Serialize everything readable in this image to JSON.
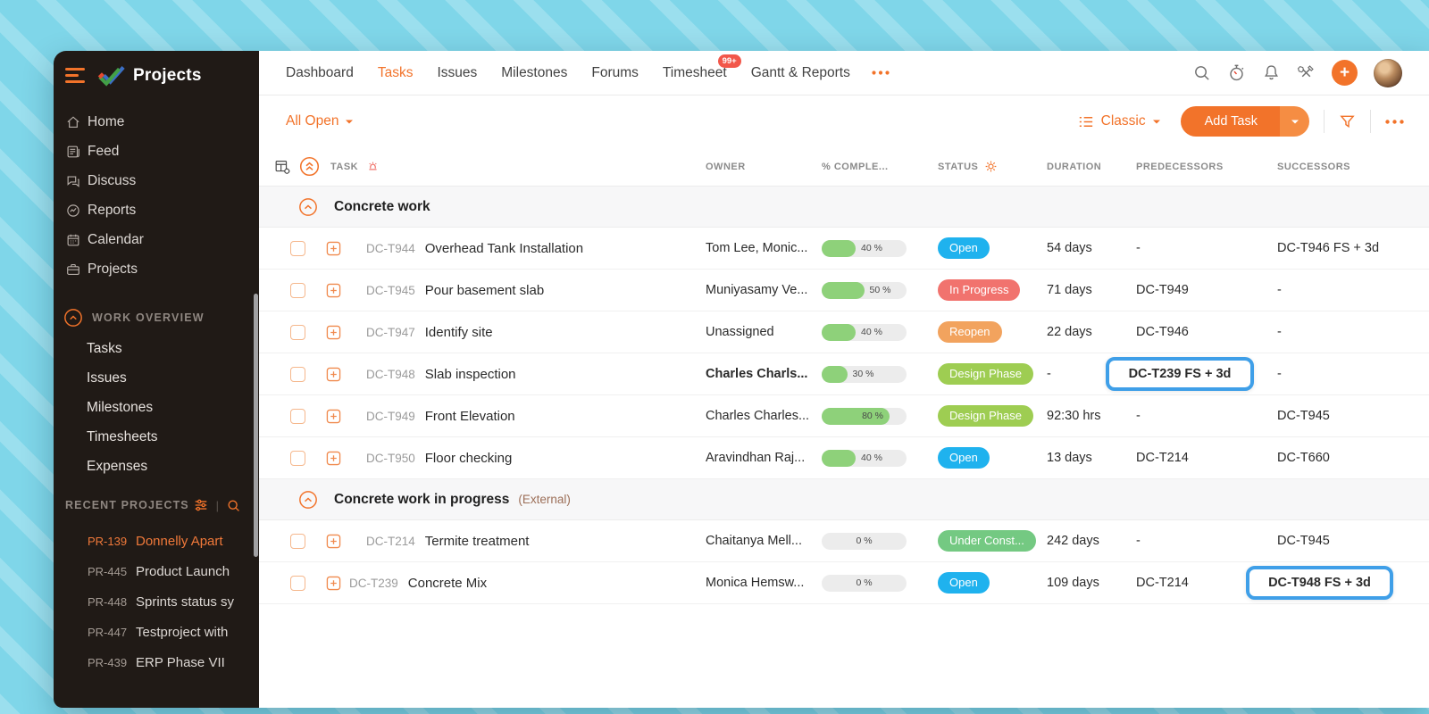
{
  "colors": {
    "accent_orange": "#f2732a",
    "highlight_blue": "#3f9fe8",
    "progress_green": "#8ed17a",
    "status": {
      "Open": "#1fb2ee",
      "In Progress": "#f1736e",
      "Reopen": "#f2a35e",
      "Design Phase": "#9ecd52",
      "Under Const...": "#74c982"
    }
  },
  "brand": {
    "title": "Projects"
  },
  "topnav": {
    "items": [
      {
        "label": "Dashboard"
      },
      {
        "label": "Tasks",
        "active": true
      },
      {
        "label": "Issues"
      },
      {
        "label": "Milestones"
      },
      {
        "label": "Forums"
      },
      {
        "label": "Timesheet",
        "badge": "99+"
      },
      {
        "label": "Gantt & Reports"
      }
    ]
  },
  "sidebar": {
    "menu": [
      {
        "icon": "home",
        "label": "Home"
      },
      {
        "icon": "feed",
        "label": "Feed"
      },
      {
        "icon": "discuss",
        "label": "Discuss"
      },
      {
        "icon": "reports",
        "label": "Reports"
      },
      {
        "icon": "calendar",
        "label": "Calendar"
      },
      {
        "icon": "projects",
        "label": "Projects"
      }
    ],
    "work_overview": {
      "label": "WORK OVERVIEW",
      "items": [
        "Tasks",
        "Issues",
        "Milestones",
        "Timesheets",
        "Expenses"
      ]
    },
    "recent_projects": {
      "label": "RECENT PROJECTS",
      "items": [
        {
          "id": "PR-139",
          "name": "Donnelly Apart",
          "active": true
        },
        {
          "id": "PR-445",
          "name": "Product Launch"
        },
        {
          "id": "PR-448",
          "name": "Sprints status sy"
        },
        {
          "id": "PR-447",
          "name": "Testproject with"
        },
        {
          "id": "PR-439",
          "name": "ERP Phase VII"
        }
      ]
    }
  },
  "toolbar": {
    "filter_label": "All Open",
    "view_label": "Classic",
    "add_task_label": "Add Task"
  },
  "table": {
    "columns": [
      "TASK",
      "OWNER",
      "% COMPLE...",
      "STATUS",
      "DURATION",
      "PREDECESSORS",
      "SUCCESSORS"
    ],
    "groups": [
      {
        "name": "Concrete work",
        "suffix": "",
        "rows": [
          {
            "id": "DC-T944",
            "name": "Overhead Tank Installation",
            "owner": "Tom Lee, Monic...",
            "progress": 40,
            "progress_label": "40 %",
            "status": "Open",
            "duration": "54 days",
            "predecessors": "-",
            "successors": "DC-T946 FS + 3d"
          },
          {
            "id": "DC-T945",
            "name": "Pour basement slab",
            "owner": "Muniyasamy Ve...",
            "progress": 50,
            "progress_label": "50 %",
            "status": "In Progress",
            "duration": "71 days",
            "predecessors": "DC-T949",
            "successors": "-"
          },
          {
            "id": "DC-T947",
            "name": "Identify site",
            "owner": "Unassigned",
            "progress": 40,
            "progress_label": "40 %",
            "status": "Reopen",
            "duration": "22 days",
            "predecessors": "DC-T946",
            "successors": "-"
          },
          {
            "id": "DC-T948",
            "name": "Slab inspection",
            "owner": "Charles Charls...",
            "owner_bold": true,
            "progress": 30,
            "progress_label": "30 %",
            "status": "Design Phase",
            "duration": "-",
            "predecessors": "DC-T239 FS + 3d",
            "pred_highlight": true,
            "successors": "-"
          },
          {
            "id": "DC-T949",
            "name": "Front Elevation",
            "owner": "Charles Charles...",
            "progress": 80,
            "progress_label": "80 %",
            "status": "Design Phase",
            "duration": "92:30 hrs",
            "predecessors": "-",
            "successors": "DC-T945"
          },
          {
            "id": "DC-T950",
            "name": "Floor checking",
            "owner": "Aravindhan Raj...",
            "progress": 40,
            "progress_label": "40 %",
            "status": "Open",
            "duration": "13 days",
            "predecessors": "DC-T214",
            "successors": "DC-T660"
          }
        ]
      },
      {
        "name": "Concrete work in progress",
        "suffix": "(External)",
        "rows": [
          {
            "id": "DC-T214",
            "name": "Termite treatment",
            "owner": "Chaitanya Mell...",
            "progress": 0,
            "progress_label": "0 %",
            "status": "Under Const...",
            "duration": "242 days",
            "predecessors": "-",
            "successors": "DC-T945"
          },
          {
            "id": "DC-T239",
            "name": "Concrete Mix",
            "owner": "Monica Hemsw...",
            "progress": 0,
            "progress_label": "0 %",
            "status": "Open",
            "duration": "109 days",
            "predecessors": "DC-T214",
            "successors": "DC-T948 FS + 3d",
            "succ_highlight": true,
            "expander": true
          }
        ]
      }
    ]
  },
  "icons": {
    "hamburger": "three-bars",
    "search": "magnifier",
    "timer": "stopwatch",
    "notifications": "bell",
    "tools": "wrench-screwdriver",
    "add": "plus-circle",
    "more": "ellipsis",
    "collapse_all": "circle-double-chevron-up",
    "group_collapse": "circle-chevron-up",
    "column_settings": "table-gear",
    "task_alarm": "siren",
    "status_gear": "gear",
    "classic_view": "list",
    "filter": "funnel",
    "recent_sort": "sliders",
    "recent_search": "magnifier",
    "expand_subtasks": "plus-square",
    "caret": "triangle-down"
  }
}
